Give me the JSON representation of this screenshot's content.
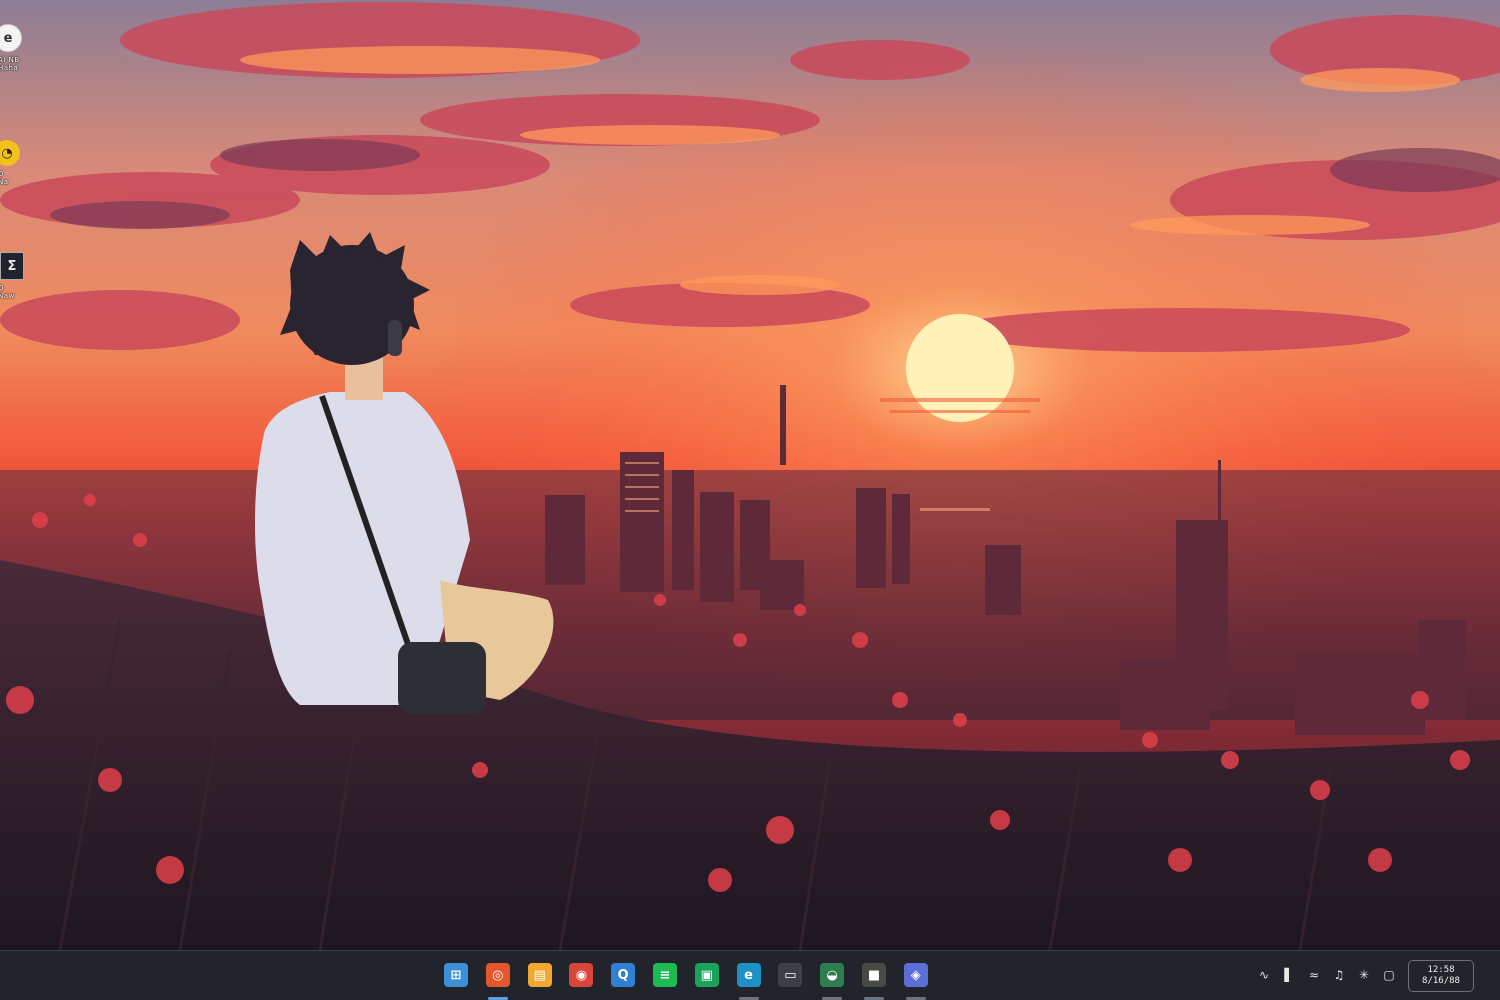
{
  "desktop": {
    "icons": [
      {
        "name": "app-shortcut-1",
        "glyph": "e",
        "label": "AI NB\nHaha"
      },
      {
        "name": "app-shortcut-2",
        "glyph": "◔",
        "label": "D\nNa"
      },
      {
        "name": "app-shortcut-3",
        "glyph": "Σ",
        "label": "O\nNaw"
      }
    ]
  },
  "taskbar": {
    "apps": [
      {
        "icon": "start-icon",
        "glyph": "⊞",
        "color": "#3d8fd6",
        "running": false
      },
      {
        "icon": "browser-icon",
        "glyph": "◎",
        "color": "#e5572b",
        "running": true
      },
      {
        "icon": "file-explorer-icon",
        "glyph": "▤",
        "color": "#f0a830",
        "running": false
      },
      {
        "icon": "chrome-icon",
        "glyph": "◉",
        "color": "#d9453a",
        "running": false
      },
      {
        "icon": "qbittorrent-icon",
        "glyph": "Q",
        "color": "#2f7fd2",
        "running": false
      },
      {
        "icon": "spotify-icon",
        "glyph": "≡",
        "color": "#1db954",
        "running": false
      },
      {
        "icon": "chat-icon",
        "glyph": "▣",
        "color": "#1aa35a",
        "running": false
      },
      {
        "icon": "edge-icon",
        "glyph": "e",
        "color": "#1e90c8",
        "running": true
      },
      {
        "icon": "terminal-icon",
        "glyph": "▭",
        "color": "#3b3f48",
        "running": false
      },
      {
        "icon": "notes-icon",
        "glyph": "◒",
        "color": "#2e7d4f",
        "running": true
      },
      {
        "icon": "media-icon",
        "glyph": "■",
        "color": "#4a4a44",
        "running": true
      },
      {
        "icon": "assistant-icon",
        "glyph": "◈",
        "color": "#5b6fd6",
        "running": true
      }
    ],
    "tray": [
      {
        "icon": "wifi-icon",
        "glyph": "∿"
      },
      {
        "icon": "battery-icon",
        "glyph": "▌"
      },
      {
        "icon": "network-icon",
        "glyph": "≈"
      },
      {
        "icon": "volume-icon",
        "glyph": "♫"
      },
      {
        "icon": "bluetooth-icon",
        "glyph": "✳"
      },
      {
        "icon": "notification-icon",
        "glyph": "▢"
      }
    ],
    "clock": {
      "time": "12:58",
      "date": "8/16/88"
    }
  }
}
